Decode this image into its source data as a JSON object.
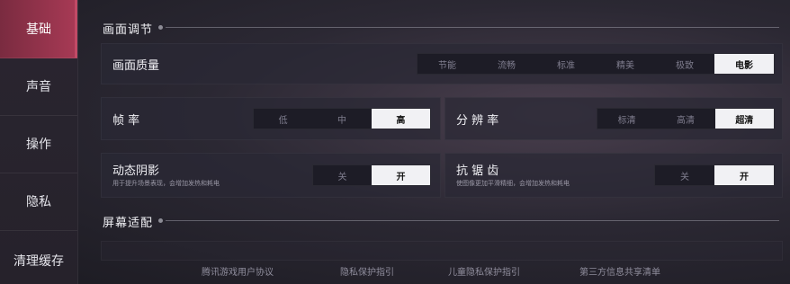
{
  "sidebar": {
    "items": [
      {
        "label": "基础",
        "active": true
      },
      {
        "label": "声音",
        "active": false
      },
      {
        "label": "操作",
        "active": false
      },
      {
        "label": "隐私",
        "active": false
      },
      {
        "label": "清理缓存",
        "active": false
      }
    ]
  },
  "sections": {
    "picture": {
      "title": "画面调节"
    },
    "screen": {
      "title": "屏幕适配"
    }
  },
  "settings": {
    "quality": {
      "label": "画面质量",
      "options": [
        "节能",
        "流畅",
        "标准",
        "精美",
        "极致",
        "电影"
      ],
      "selected": "电影"
    },
    "framerate": {
      "label": "帧 率",
      "options": [
        "低",
        "中",
        "高"
      ],
      "selected": "高"
    },
    "resolution": {
      "label": "分 辨 率",
      "options": [
        "标清",
        "高清",
        "超清"
      ],
      "selected": "超清"
    },
    "shadow": {
      "label": "动态阴影",
      "desc": "用于提升场景表现，会增加发热和耗电",
      "options": [
        "关",
        "开"
      ],
      "selected": "开"
    },
    "antialias": {
      "label": "抗 锯 齿",
      "desc": "使图像更加平滑精细，会增加发热和耗电",
      "options": [
        "关",
        "开"
      ],
      "selected": "开"
    }
  },
  "footer": {
    "links": [
      "腾讯游戏用户协议",
      "隐私保护指引",
      "儿童隐私保护指引",
      "第三方信息共享清单"
    ]
  },
  "colors": {
    "accent": "#a83a55",
    "selected_bg": "#f1f1f4"
  }
}
